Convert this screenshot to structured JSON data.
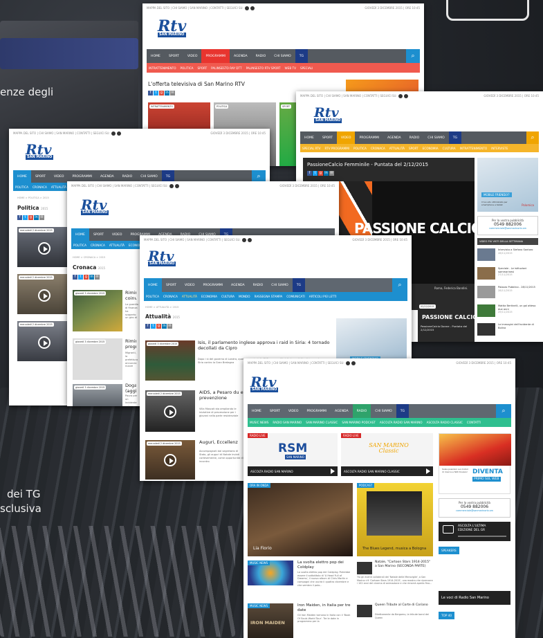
{
  "background": {
    "text_top": "enze degli",
    "text_bottom_1": "dei TG",
    "text_bottom_2": "sclusiva"
  },
  "common": {
    "utility_left": "MAPPA DEL SITO | CHI SIAMO | SAN MARINO | CONTATTI | SEGUICI SU:",
    "utility_date": "GIOVEDÌ 3 DICEMBRE 2015 | ORE 10:45",
    "logo": "Rtv",
    "logo_sub": "SAN MARINO",
    "search_icon": "⌕"
  },
  "shot_programmi": {
    "nav": [
      "HOME",
      "SPORT",
      "VIDEO",
      "PROGRAMMI",
      "AGENDA",
      "RADIO",
      "CHI SIAMO",
      "TG"
    ],
    "subnav": [
      "INTRATTENIMENTO",
      "POLITICA",
      "SPORT",
      "PALINSESTO RAY DTT",
      "PALINSESTO RTV SPORT",
      "WEB TV",
      "SPECIALI"
    ],
    "heading": "L'offerta televisiva di San Marino RTV",
    "tiles": [
      "INTRATTENIMENTO",
      "POLITICA",
      "SPORT"
    ]
  },
  "shot_sport": {
    "nav": [
      "HOME",
      "SPORT",
      "VIDEO",
      "PROGRAMMI",
      "AGENDA",
      "RADIO",
      "CHI SIAMO",
      "TG"
    ],
    "subnav": [
      "SPECIAL RTV",
      "RTV PROGRAMMI",
      "POLITICA",
      "CRONACA",
      "ATTUALITÀ",
      "SPORT",
      "ECONOMIA",
      "CULTURA",
      "INTRATTENIMENTO",
      "INTERVISTE"
    ],
    "video_title": "PassioneCalcio Femminile - Puntata del 2/12/2015",
    "video_logo": "PASSIONE CALCIO",
    "caption": "Roma, Federica Bandini.",
    "card_date": "02/12/2015",
    "card_logo": "PASSIONE CALCIO",
    "card_text": "PassioneCalcio Donne - Puntata del 2/12/2015",
    "ad_text": "MOBILE FRIENDLY?",
    "ad_sub": "Il tuo sito ottimizzato per smartphone e tablet",
    "ad_brand": "Polomica",
    "pub_1": "Per la vostra pubblicità",
    "pub_2": "0549 882006",
    "pub_3": "commerciale@sanmarinortv.sm",
    "most_viewed": "VIDEO PIÙ VISTI DELLA SETTIMANA",
    "items": [
      {
        "t": "Intervista a Stefano Santoro",
        "d": "28/11/2015"
      },
      {
        "t": "Speciale - Le istituzioni sammarinesi",
        "d": "27/11/2015"
      },
      {
        "t": "Palazzo Pubblico - 28/11/2015",
        "d": "28/11/2015"
      },
      {
        "t": "Mattia Bertinelli, un gol atteso due anni",
        "d": "29/11/2015"
      },
      {
        "t": "Le immagini dell'incidente di Bolina",
        "d": "30/11/2015"
      }
    ]
  },
  "shot_politica": {
    "nav": [
      "HOME",
      "SPORT",
      "VIDEO",
      "PROGRAMMI",
      "AGENDA",
      "RADIO",
      "CHI SIAMO",
      "TG"
    ],
    "subnav": [
      "POLITICA",
      "CRONACA",
      "ATTUALITÀ"
    ],
    "crumb": "HOME > POLITICA > 2015",
    "title": "Politica",
    "year": "2015",
    "cards": [
      {
        "d": "mercoledì 2 dicembre 2015",
        "t": "Rimin coinv"
      },
      {
        "d": "mercoledì 2 dicembre 2015",
        "t": ""
      },
      {
        "d": "mercoledì 2 dicembre 2015",
        "t": "Rimin progr"
      }
    ]
  },
  "shot_cronaca": {
    "nav": [
      "HOME",
      "SPORT",
      "VIDEO",
      "PROGRAMMI",
      "AGENDA",
      "RADIO",
      "CHI SIAMO",
      "TG"
    ],
    "subnav": [
      "POLITICA",
      "CRONACA",
      "ATTUALITÀ",
      "ECONOMIA"
    ],
    "crumb": "HOME > CRONACA > 2015",
    "title": "Cronaca",
    "year": "2015",
    "cards": [
      {
        "d": "giovedì 3 dicembre 2015",
        "t": "Rimin coinv",
        "x": "La guardia di finanza ha scoperto un giro di fatture false nel riminese"
      },
      {
        "d": "giovedì 3 dicembre 2015",
        "t": "Rimin progr",
        "x": "Migranti, la prefettura annuncia nuove strutture di accoglienza"
      },
      {
        "d": "giovedì 3 dicembre 2015",
        "t": "Doga (aggi",
        "x": "Paura per un incidente sulla superstrada, coinvolto un veicolo"
      }
    ]
  },
  "shot_attualita": {
    "nav": [
      "HOME",
      "SPORT",
      "VIDEO",
      "PROGRAMMI",
      "AGENDA",
      "RADIO",
      "CHI SIAMO",
      "TG"
    ],
    "subnav": [
      "POLITICA",
      "CRONACA",
      "ATTUALITÀ",
      "ECONOMIA",
      "CULTURA",
      "MONDO",
      "RASSEGNA STAMPA",
      "COMUNICATI",
      "ARTICOLI PIÙ LETTI"
    ],
    "crumb": "HOME > ATTUALITÀ > 2015",
    "title": "Attualità",
    "year": "2015",
    "articles": [
      {
        "d": "giovedì 3 dicembre 2015",
        "t": "Isis, il parlamento inglese approva i raid in Siria: 4 tornado decollati da Cipro",
        "x": "Dopo i sì del governo di Londra, quattro caccia della RAF sono partiti dalla base di Akrotiri verso la Siria contro la Gran Bretagna"
      },
      {
        "d": "mercoledì 2 dicembre 2015",
        "t": "AIDS, a Pesaro du e prevenzione",
        "x": "Villa Moscati sta ampliando le iniziative di prevenzione per i giovani nella parte residenziale"
      },
      {
        "d": "mercoledì 2 dicembre 2015",
        "t": "Auguri, Eccellenz",
        "x": "Accompagnati dal segretario di Stato, gli auguri di Natale inviati cortesemente, come opportunità di incontro"
      }
    ],
    "ad": "MOBILE FRIENDLY?"
  },
  "shot_radio": {
    "nav": [
      "HOME",
      "SPORT",
      "VIDEO",
      "PROGRAMMI",
      "AGENDA",
      "RADIO",
      "CHI SIAMO",
      "TG"
    ],
    "subnav": [
      "MUSIC NEWS",
      "RADIO SAN MARINO",
      "SAN MARINO CLASSIC",
      "SAN MARINO PODCAST",
      "ASCOLTA RADIO SAN MARINO",
      "ASCOLTA RADIO CLASSIC",
      "CONTATTI"
    ],
    "live_label": "RADIO LIVE",
    "rsm_logo": "RSM",
    "rsm_sub": "SAN MARINO",
    "classic_logo": "SAN MARINO Classic",
    "listen_1": "ASCOLTA RADIO SAN MARINO",
    "listen_2": "ASCOLTA RADIO SAN MARINO CLASSIC",
    "onair_label": "ORA IN ONDA",
    "host": "Lia Fiorio",
    "podcast_label": "PODCAST",
    "podcast_title": "The Blues Legend, musica a Bologna",
    "news": [
      {
        "label": "MUSIC NEWS",
        "t": "La svolta elettro pop dei Coldplay",
        "x": "La svolta elettro pop dei Coldplay. Potrebbe essere il sottotitolo di 'A Head Full of Dreams', il nuovo album di Chris Martin e compagni che uscirà il quattro dicembre e che sembra il polo..."
      },
      {
        "label": "MUSIC NEWS",
        "t": "Iron Maiden, in Italia per tre date",
        "x": "Gli Iron Maiden tornano in Italia con il 'Book Of Souls World Tour'. Tre le date in programma per la"
      }
    ],
    "iron_logo": "IRON MAIDEN",
    "agenda": [
      {
        "t": "Natale, \"Cartoon Stars 1914-2015\" a San Marino (SECONDA PARTE)",
        "x": "Tra gli eventi collaterali del 'Natale delle Meraviglie', a San Marino c'è 'Cartoon Stars 1914-2015', una mostra che ripercorre i 102 anni del cinema di animazione e che rimarrà aperta fino..."
      },
      {
        "t": "Queen Tribute al Corte di Coriano",
        "x": "Direttamente da Bergamo, la tribute band dei Queen"
      }
    ],
    "ad_title": "DIVENTA",
    "ad_sub": "PRIMO SUL WEB",
    "ad_small": "Scala posizioni sui motori di ricerca e fatti trovare!",
    "pub_1": "Per la vostra pubblicità",
    "pub_2": "0549 882006",
    "pub_3": "commerciale@sanmarinortv.sm",
    "last_tg_1": "ASCOLTA L'ULTIMA",
    "last_tg_2": "EDIZIONE DEL GR",
    "speakers": "SPEAKERS",
    "voices": "Le voci di Radio San Marino",
    "top": "TOP 40"
  }
}
